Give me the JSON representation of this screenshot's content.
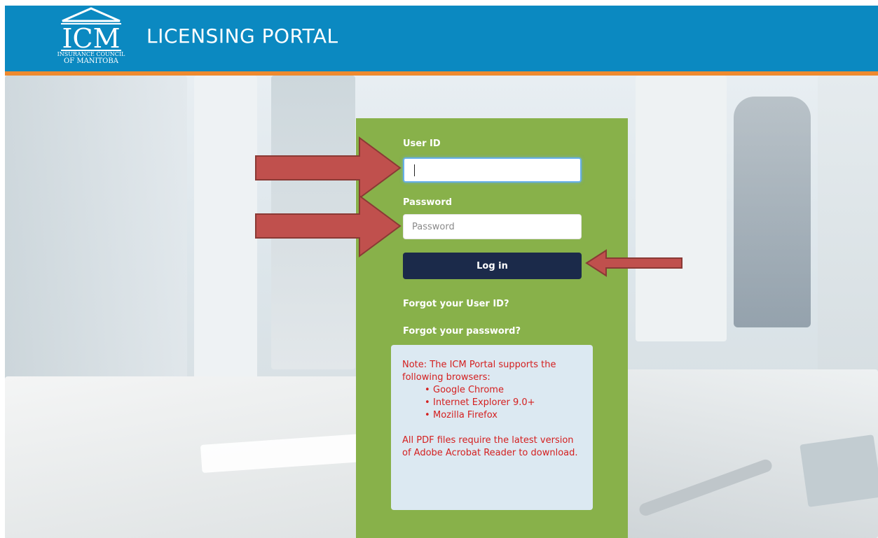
{
  "header": {
    "logo_abbrev": "ICM",
    "logo_line1": "INSURANCE COUNCIL",
    "logo_line2": "OF MANITOBA",
    "portal_title": "LICENSING PORTAL"
  },
  "login": {
    "user_label": "User ID",
    "user_value": "",
    "password_label": "Password",
    "password_placeholder": "Password",
    "login_button": "Log in",
    "forgot_user_link": "Forgot your User ID?",
    "forgot_password_link": "Forgot your password?"
  },
  "note": {
    "intro": "Note: The ICM Portal supports the following browsers:",
    "browsers": [
      "Google Chrome",
      "Internet Explorer 9.0+",
      "Mozilla Firefox"
    ],
    "pdf_note": "All PDF files require the latest version of Adobe Acrobat Reader to download."
  },
  "colors": {
    "header": "#0b89c1",
    "stripe": "#ee8a2f",
    "panel": "#88b14a",
    "button": "#1b2a4a",
    "note_bg": "#dce9f2",
    "note_text": "#d42020",
    "arrow": "#c0504d"
  },
  "icons": [
    "icm-building-logo",
    "right-arrow-annotation",
    "left-arrow-annotation"
  ]
}
